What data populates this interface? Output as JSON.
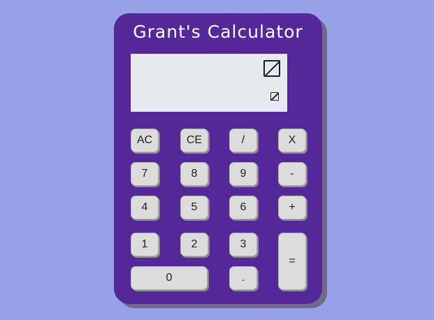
{
  "calculator": {
    "title": "Grant's Calculator",
    "display": {
      "previous_value": "",
      "current_value": ""
    },
    "keys": {
      "ac": "AC",
      "ce": "CE",
      "divide": "/",
      "multiply": "X",
      "seven": "7",
      "eight": "8",
      "nine": "9",
      "subtract": "-",
      "four": "4",
      "five": "5",
      "six": "6",
      "add": "+",
      "one": "1",
      "two": "2",
      "three": "3",
      "equals": "=",
      "zero": "0",
      "decimal": "."
    }
  },
  "colors": {
    "background": "#98a1e8",
    "calculator_body": "#55289a",
    "display": "#e6e9ee",
    "key": "#dcdcdc"
  }
}
